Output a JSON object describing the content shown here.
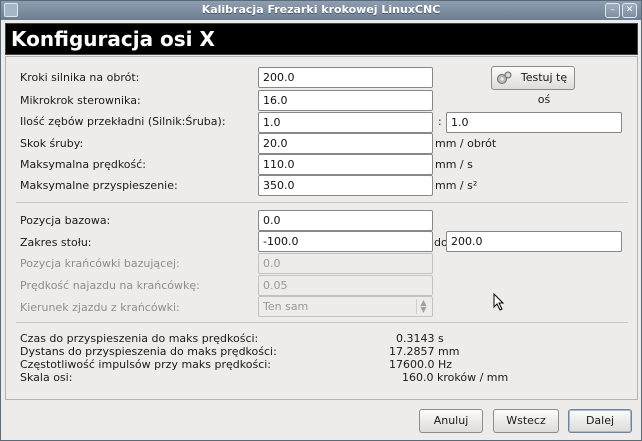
{
  "window": {
    "title": "Kalibracja Frezarki krokowej LinuxCNC",
    "min_symbol": "–",
    "close_symbol": "✕"
  },
  "header": {
    "title": "Konfiguracja osi X"
  },
  "form": {
    "steps_per_rev": {
      "label": "Kroki silnika na obrót:",
      "value": "200.0"
    },
    "test_button": {
      "label": "Testuj tę oś",
      "icon": "gears-icon"
    },
    "microstep": {
      "label": "Mikrokrok sterownika:",
      "value": "16.0"
    },
    "gear_ratio": {
      "label": "Ilość zębów przekładni (Silnik:Śruba):",
      "value_motor": "1.0",
      "separator": ":",
      "value_screw": "1.0"
    },
    "screw_pitch": {
      "label": "Skok śruby:",
      "value": "20.0",
      "unit": "mm / obrót"
    },
    "max_velocity": {
      "label": "Maksymalna prędkość:",
      "value": "110.0",
      "unit": "mm / s"
    },
    "max_accel": {
      "label": "Maksymalne przyspieszenie:",
      "value": "350.0",
      "unit": "mm / s²"
    },
    "home_position": {
      "label": "Pozycja bazowa:",
      "value": "0.0"
    },
    "table_travel": {
      "label": "Zakres stołu:",
      "value_min": "-100.0",
      "to_label": "do",
      "value_max": "200.0"
    },
    "home_switch_pos": {
      "label": "Pozycja krańcówki bazującej:",
      "value": "0.0"
    },
    "home_search_vel": {
      "label": "Prędkość najazdu na krańcówkę:",
      "value": "0.05"
    },
    "home_direction": {
      "label": "Kierunek zjazdu z krańcówki:",
      "value": "Ten sam"
    }
  },
  "info": [
    {
      "label": "Czas do przyspieszenia do maks prędkości:",
      "value": "0.3143 s"
    },
    {
      "label": "Dystans do przyspieszenia do maks prędkości:",
      "value": "17.2857 mm"
    },
    {
      "label": "Częstotliwość impulsów przy maks prędkości:",
      "value": "17600.0 Hz"
    },
    {
      "label": "Skala osi:",
      "value": "160.0 kroków / mm"
    }
  ],
  "buttons": {
    "cancel": "Anuluj",
    "back": "Wstecz",
    "next": "Dalej"
  }
}
